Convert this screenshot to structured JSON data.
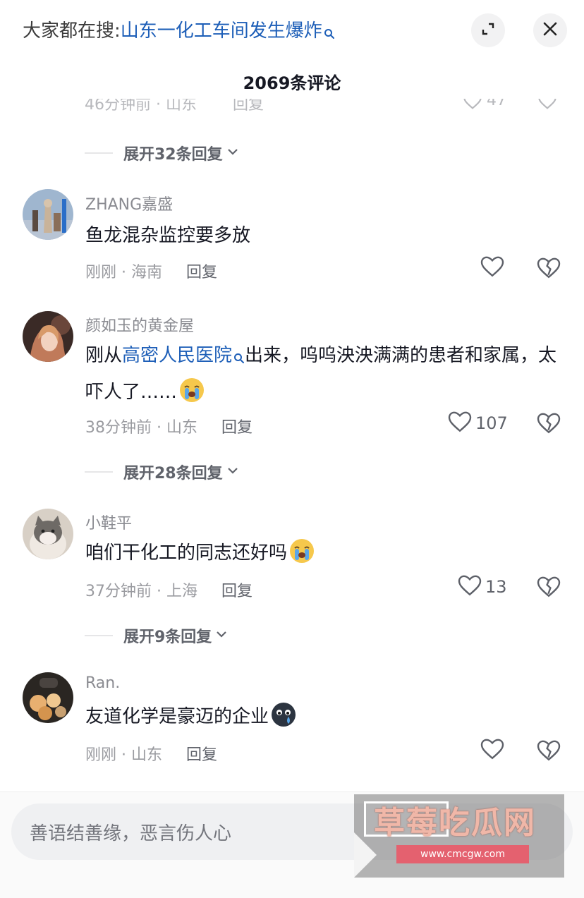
{
  "header": {
    "search_prefix": "大家都在搜:",
    "search_term": "山东一化工车间发生爆炸",
    "title": "2069条评论"
  },
  "partial_row": {
    "time": "46分钟前 · 山东",
    "reply": "回复",
    "likes": "47"
  },
  "expand_1": {
    "label": "展开32条回复"
  },
  "comments": [
    {
      "username": "ZHANG嘉盛",
      "text": "鱼龙混杂监控要多放",
      "time": "刚刚 · 海南",
      "reply": "回复",
      "likes": ""
    },
    {
      "username": "颜如玉的黄金屋",
      "text_prefix": "刚从",
      "text_link": "高密人民医院",
      "text_suffix": "出来，呜呜泱泱满满的患者和家属，太吓人了……",
      "time": "38分钟前 · 山东",
      "reply": "回复",
      "likes": "107"
    },
    {
      "username": "小鞋平",
      "text": "咱们干化工的同志还好吗",
      "time": "37分钟前 · 上海",
      "reply": "回复",
      "likes": "13"
    },
    {
      "username": "Ran.",
      "text": "友道化学是豪迈的企业",
      "time": "刚刚 · 山东",
      "reply": "回复",
      "likes": ""
    }
  ],
  "expand_2": {
    "label": "展开28条回复"
  },
  "expand_3": {
    "label": "展开9条回复"
  },
  "input": {
    "placeholder": "善语结善缘，恶言伤人心"
  },
  "watermark": {
    "title": "草莓吃瓜网",
    "url": "www.cmcgw.com"
  },
  "icons": {
    "search_hint": "search-icon",
    "collapse": "collapse-icon",
    "close": "close-icon",
    "expand": "chevron-down-icon",
    "like": "heart-icon",
    "dislike": "broken-heart-icon",
    "emoji_crying": "crying-emoji",
    "emoji_dark": "dark-face-emoji"
  },
  "colors": {
    "link": "#1e5fb8",
    "text": "#161823",
    "muted": "#9a9ba0"
  }
}
